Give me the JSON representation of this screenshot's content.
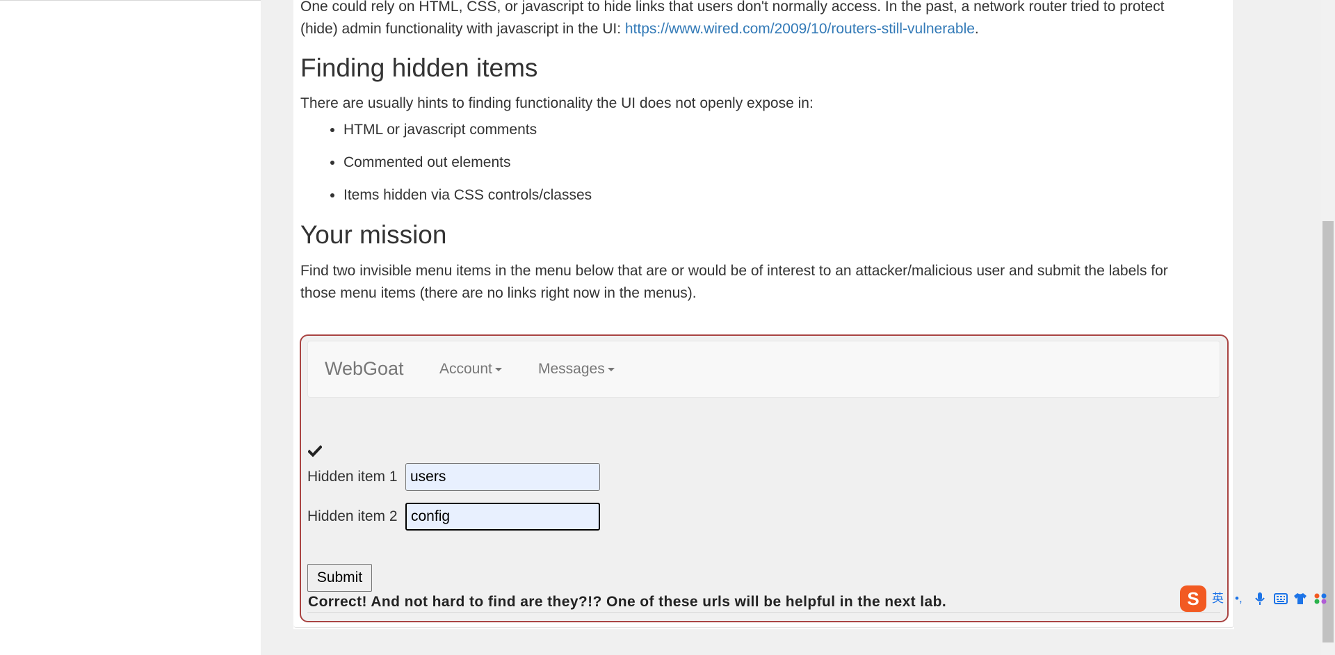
{
  "intro": {
    "text": "One could rely on HTML, CSS, or javascript to hide links that users don't normally access. In the past, a network router tried to protect (hide) admin functionality with javascript in the UI: ",
    "link_text": "https://www.wired.com/2009/10/routers-still-vulnerable",
    "trailing": "."
  },
  "finding": {
    "heading": "Finding hidden items",
    "text": "There are usually hints to finding functionality the UI does not openly expose in:",
    "items": [
      "HTML or javascript comments",
      "Commented out elements",
      "Items hidden via CSS controls/classes"
    ]
  },
  "mission": {
    "heading": "Your mission",
    "text": "Find two invisible menu items in the menu below that are or would be of interest to an attacker/malicious user and submit the labels for those menu items (there are no links right now in the menus)."
  },
  "navbar": {
    "brand": "WebGoat",
    "menus": [
      "Account",
      "Messages"
    ]
  },
  "form": {
    "field1_label": "Hidden item 1",
    "field1_value": "users",
    "field2_label": "Hidden item 2",
    "field2_value": "config",
    "submit_label": "Submit"
  },
  "feedback": "Correct! And not hard to find are they?!? One of these urls will be helpful in the next lab.",
  "ime_toolbar": {
    "logo": "S",
    "lang": "英",
    "punct": "•,",
    "icons": [
      "microphone-icon",
      "keyboard-icon",
      "shirt-icon",
      "apps-icon"
    ]
  },
  "colors": {
    "link": "#337ab7",
    "attack_border": "#a94442",
    "input_autofill": "#e8f0fe",
    "ime_logo": "#f25a22"
  }
}
